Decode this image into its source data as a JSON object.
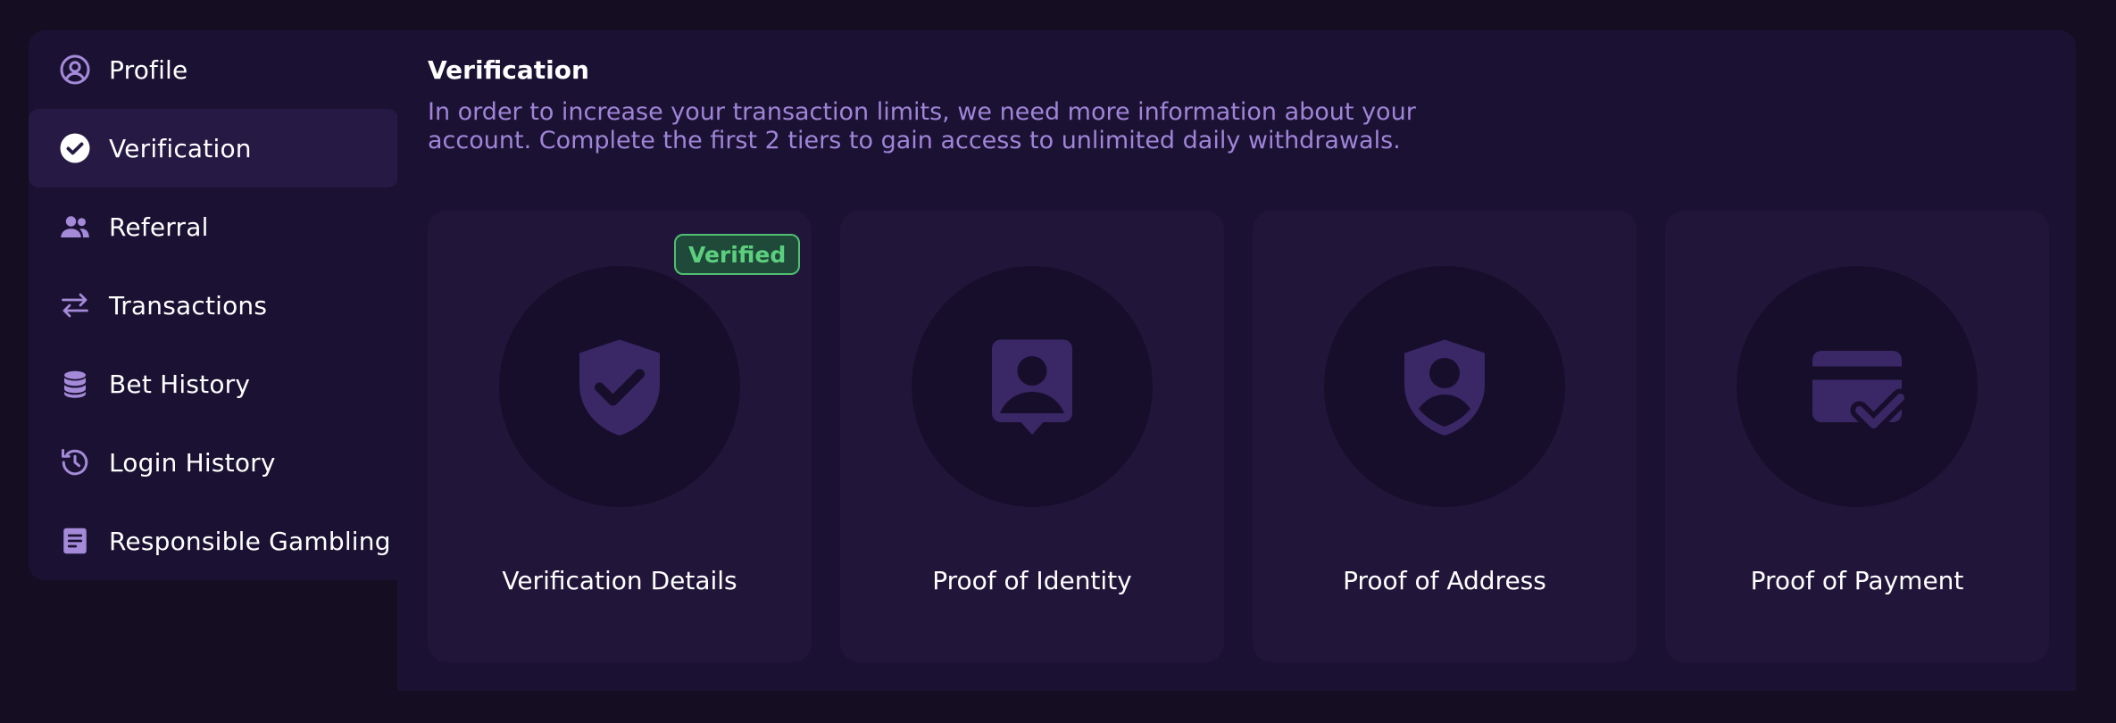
{
  "colors": {
    "background": "#150e22",
    "panel": "#1b1233",
    "active_item": "#261a44",
    "card": "#21163a",
    "icon_accent": "#a48ad8",
    "card_icon": "#3a2766",
    "description": "#a084d8",
    "verified_green": "#5ccf7e"
  },
  "sidebar": {
    "items": [
      {
        "label": "Profile",
        "icon": "user-circle-icon",
        "active": false
      },
      {
        "label": "Verification",
        "icon": "check-circle-icon",
        "active": true
      },
      {
        "label": "Referral",
        "icon": "users-icon",
        "active": false
      },
      {
        "label": "Transactions",
        "icon": "arrows-exchange-icon",
        "active": false
      },
      {
        "label": "Bet History",
        "icon": "coin-stack-icon",
        "active": false
      },
      {
        "label": "Login History",
        "icon": "history-clock-icon",
        "active": false
      },
      {
        "label": "Responsible Gambling",
        "icon": "document-icon",
        "active": false
      }
    ]
  },
  "main": {
    "title": "Verification",
    "description": "In order to increase your transaction limits, we need more information about your account. Complete the first 2 tiers to gain access to unlimited daily withdrawals.",
    "cards": [
      {
        "label": "Verification Details",
        "icon": "shield-check-icon",
        "badge": "Verified"
      },
      {
        "label": "Proof of Identity",
        "icon": "id-portrait-icon"
      },
      {
        "label": "Proof of Address",
        "icon": "shield-user-icon"
      },
      {
        "label": "Proof of Payment",
        "icon": "card-check-icon"
      }
    ]
  }
}
